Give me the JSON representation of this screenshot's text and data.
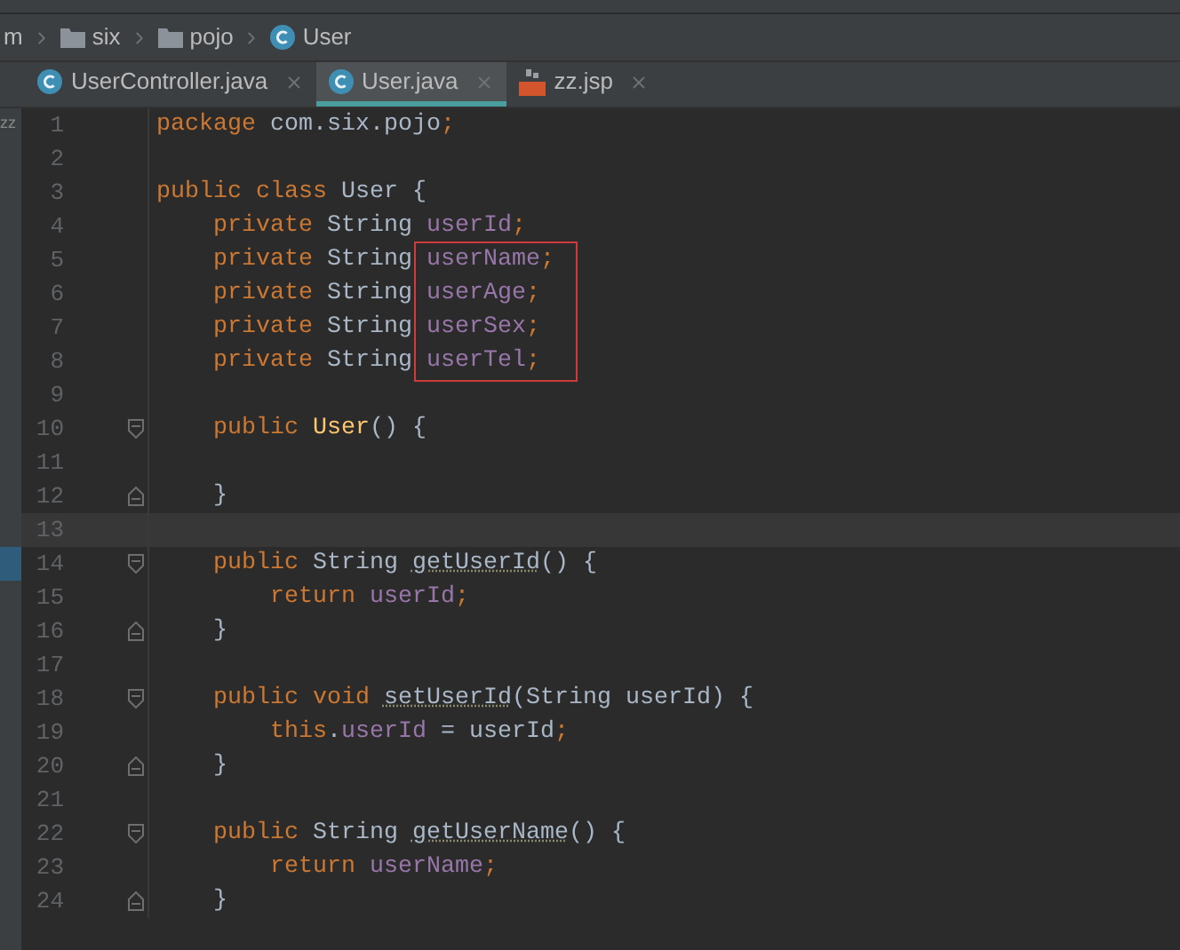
{
  "breadcrumbs": [
    {
      "label": "m",
      "kind": "text"
    },
    {
      "label": "six",
      "kind": "folder"
    },
    {
      "label": "pojo",
      "kind": "folder"
    },
    {
      "label": "User",
      "kind": "class"
    }
  ],
  "tabs": [
    {
      "label": "UserController.java",
      "kind": "class",
      "selected": false
    },
    {
      "label": "User.java",
      "kind": "class",
      "selected": true
    },
    {
      "label": "zz.jsp",
      "kind": "jsp",
      "selected": false
    }
  ],
  "side_strip_label": "zz",
  "annotation": {
    "kind": "box",
    "color": "#d03a3a"
  },
  "lines": [
    {
      "number": "1",
      "tokens": [
        {
          "text": "package",
          "kind": "keyword"
        },
        {
          "text": " com.six.pojo",
          "kind": "plain"
        },
        {
          "text": ";",
          "kind": "keyword"
        }
      ]
    },
    {
      "number": "2"
    },
    {
      "number": "3",
      "tokens": [
        {
          "text": "public class",
          "kind": "keyword"
        },
        {
          "text": " User {",
          "kind": "plain"
        }
      ]
    },
    {
      "number": "4",
      "tokens": [
        {
          "text": "    private",
          "kind": "keyword"
        },
        {
          "text": " String ",
          "kind": "plain"
        },
        {
          "text": "userId",
          "kind": "field"
        },
        {
          "text": ";",
          "kind": "keyword"
        }
      ]
    },
    {
      "number": "5",
      "boxed": true,
      "tokens": [
        {
          "text": "    private",
          "kind": "keyword"
        },
        {
          "text": " String ",
          "kind": "plain"
        },
        {
          "text": "userName",
          "kind": "field"
        },
        {
          "text": ";",
          "kind": "keyword"
        }
      ]
    },
    {
      "number": "6",
      "boxed": true,
      "tokens": [
        {
          "text": "    private",
          "kind": "keyword"
        },
        {
          "text": " String ",
          "kind": "plain"
        },
        {
          "text": "userAge",
          "kind": "field"
        },
        {
          "text": ";",
          "kind": "keyword"
        }
      ]
    },
    {
      "number": "7",
      "boxed": true,
      "tokens": [
        {
          "text": "    private",
          "kind": "keyword"
        },
        {
          "text": " String ",
          "kind": "plain"
        },
        {
          "text": "userSex",
          "kind": "field"
        },
        {
          "text": ";",
          "kind": "keyword"
        }
      ]
    },
    {
      "number": "8",
      "boxed": true,
      "tokens": [
        {
          "text": "    private",
          "kind": "keyword"
        },
        {
          "text": " String ",
          "kind": "plain"
        },
        {
          "text": "userTel",
          "kind": "field"
        },
        {
          "text": ";",
          "kind": "keyword"
        }
      ]
    },
    {
      "number": "9"
    },
    {
      "number": "10",
      "fold_start": true,
      "tokens": [
        {
          "text": "    public ",
          "kind": "keyword"
        },
        {
          "text": "User",
          "kind": "declaration"
        },
        {
          "text": "() {",
          "kind": "plain"
        }
      ]
    },
    {
      "number": "11"
    },
    {
      "number": "12",
      "fold_end": true,
      "tokens": [
        {
          "text": "    }",
          "kind": "plain"
        }
      ]
    },
    {
      "number": "13",
      "current": true
    },
    {
      "number": "14",
      "fold_start": true,
      "marked": true,
      "tokens": [
        {
          "text": "    public",
          "kind": "keyword"
        },
        {
          "text": " String ",
          "kind": "plain"
        },
        {
          "text": "getUserId",
          "kind": "unused"
        },
        {
          "text": "() {",
          "kind": "plain"
        }
      ]
    },
    {
      "number": "15",
      "tokens": [
        {
          "text": "        return ",
          "kind": "keyword"
        },
        {
          "text": "userId",
          "kind": "field"
        },
        {
          "text": ";",
          "kind": "keyword"
        }
      ]
    },
    {
      "number": "16",
      "fold_end": true,
      "tokens": [
        {
          "text": "    }",
          "kind": "plain"
        }
      ]
    },
    {
      "number": "17"
    },
    {
      "number": "18",
      "fold_start": true,
      "tokens": [
        {
          "text": "    public void ",
          "kind": "keyword"
        },
        {
          "text": "setUserId",
          "kind": "unused"
        },
        {
          "text": "(String userId) {",
          "kind": "plain"
        }
      ]
    },
    {
      "number": "19",
      "tokens": [
        {
          "text": "        this",
          "kind": "keyword"
        },
        {
          "text": ".",
          "kind": "plain"
        },
        {
          "text": "userId",
          "kind": "field"
        },
        {
          "text": " = userId",
          "kind": "plain"
        },
        {
          "text": ";",
          "kind": "keyword"
        }
      ]
    },
    {
      "number": "20",
      "fold_end": true,
      "tokens": [
        {
          "text": "    }",
          "kind": "plain"
        }
      ]
    },
    {
      "number": "21"
    },
    {
      "number": "22",
      "fold_start": true,
      "tokens": [
        {
          "text": "    public",
          "kind": "keyword"
        },
        {
          "text": " String ",
          "kind": "plain"
        },
        {
          "text": "getUserName",
          "kind": "unused"
        },
        {
          "text": "() {",
          "kind": "plain"
        }
      ]
    },
    {
      "number": "23",
      "tokens": [
        {
          "text": "        return ",
          "kind": "keyword"
        },
        {
          "text": "userName",
          "kind": "field"
        },
        {
          "text": ";",
          "kind": "keyword"
        }
      ]
    },
    {
      "number": "24",
      "fold_end": true,
      "tokens": [
        {
          "text": "    }",
          "kind": "plain"
        }
      ]
    }
  ]
}
